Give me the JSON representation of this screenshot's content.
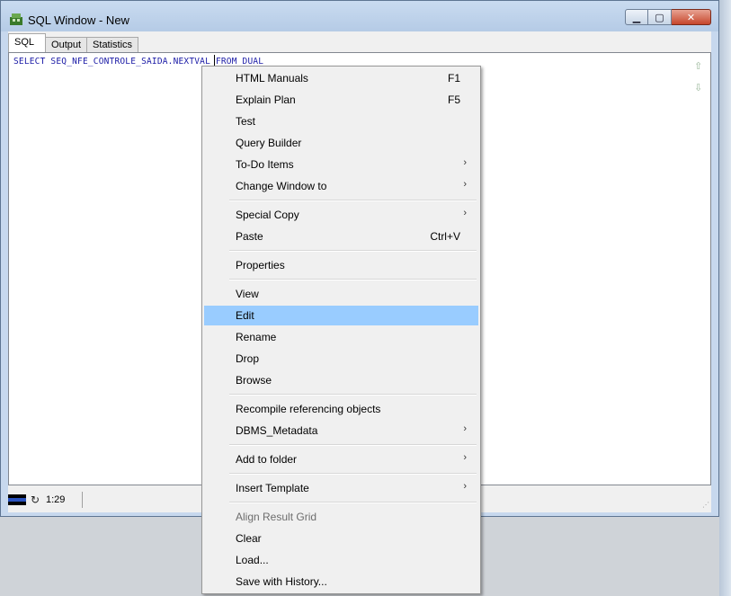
{
  "window": {
    "title": "SQL Window - New"
  },
  "tabs": [
    "SQL",
    "Output",
    "Statistics"
  ],
  "editor": {
    "code": "SELECT SEQ_NFE_CONTROLE_SAIDA.NEXTVAL FROM DUAL"
  },
  "status": {
    "position": "1:29"
  },
  "menu": {
    "items": [
      {
        "label": "HTML Manuals",
        "shortcut": "F1"
      },
      {
        "label": "Explain Plan",
        "shortcut": "F5"
      },
      {
        "label": "Test"
      },
      {
        "label": "Query Builder"
      },
      {
        "label": "To-Do Items",
        "submenu": true
      },
      {
        "label": "Change Window to",
        "submenu": true
      },
      {
        "label": "Special Copy",
        "submenu": true
      },
      {
        "label": "Paste",
        "shortcut": "Ctrl+V"
      },
      {
        "label": "Properties"
      },
      {
        "label": "View"
      },
      {
        "label": "Edit",
        "highlighted": true
      },
      {
        "label": "Rename"
      },
      {
        "label": "Drop"
      },
      {
        "label": "Browse"
      },
      {
        "label": "Recompile referencing objects"
      },
      {
        "label": "DBMS_Metadata",
        "submenu": true
      },
      {
        "label": "Add to folder",
        "submenu": true
      },
      {
        "label": "Insert Template",
        "submenu": true
      },
      {
        "label": "Align Result Grid",
        "disabled": true
      },
      {
        "label": "Clear"
      },
      {
        "label": "Load..."
      },
      {
        "label": "Save with History..."
      }
    ],
    "submenu_glyph": "›"
  },
  "colors": {
    "highlight": "#99ccff",
    "code_text": "#1a1aa6",
    "close_button": "#c6462c"
  }
}
